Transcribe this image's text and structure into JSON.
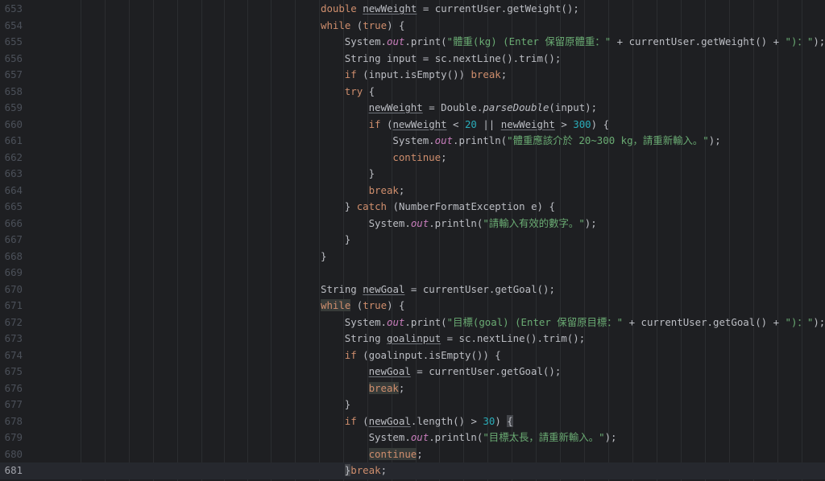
{
  "editor": {
    "theme_colors": {
      "background": "#1e1f22",
      "keyword": "#cf8e6d",
      "string": "#6aab73",
      "number": "#2aacb8",
      "static_field": "#c77dbb",
      "default_text": "#bcbec4",
      "line_number": "#4b5059",
      "current_line_number": "#a1a3ab"
    },
    "current_line": 681,
    "lines": [
      {
        "n": "653",
        "indent": 0,
        "tokens": [
          [
            "kw",
            "double"
          ],
          [
            "p",
            " "
          ],
          [
            "var",
            "newWeight"
          ],
          [
            "p",
            " = currentUser.getWeight();"
          ]
        ]
      },
      {
        "n": "654",
        "indent": 0,
        "tokens": [
          [
            "kw",
            "while"
          ],
          [
            "p",
            " ("
          ],
          [
            "kw",
            "true"
          ],
          [
            "p",
            ") {"
          ]
        ]
      },
      {
        "n": "655",
        "indent": 1,
        "tokens": [
          [
            "p",
            "System."
          ],
          [
            "static",
            "out"
          ],
          [
            "p",
            ".print("
          ],
          [
            "str",
            "\"體重(kg) (Enter 保留原體重：\""
          ],
          [
            "p",
            " + currentUser.getWeight() + "
          ],
          [
            "str",
            "\")：\""
          ],
          [
            "p",
            ");"
          ]
        ]
      },
      {
        "n": "656",
        "indent": 1,
        "tokens": [
          [
            "p",
            "String input = sc.nextLine().trim();"
          ]
        ]
      },
      {
        "n": "657",
        "indent": 1,
        "tokens": [
          [
            "kw",
            "if"
          ],
          [
            "p",
            " (input.isEmpty()) "
          ],
          [
            "kw",
            "break"
          ],
          [
            "p",
            ";"
          ]
        ]
      },
      {
        "n": "658",
        "indent": 1,
        "tokens": [
          [
            "kw",
            "try"
          ],
          [
            "p",
            " {"
          ]
        ]
      },
      {
        "n": "659",
        "indent": 2,
        "tokens": [
          [
            "var",
            "newWeight"
          ],
          [
            "p",
            " = Double."
          ],
          [
            "it",
            "parseDouble"
          ],
          [
            "p",
            "(input);"
          ]
        ]
      },
      {
        "n": "660",
        "indent": 2,
        "tokens": [
          [
            "kw",
            "if"
          ],
          [
            "p",
            " ("
          ],
          [
            "var",
            "newWeight"
          ],
          [
            "p",
            " < "
          ],
          [
            "num",
            "20"
          ],
          [
            "p",
            " || "
          ],
          [
            "var",
            "newWeight"
          ],
          [
            "p",
            " > "
          ],
          [
            "num",
            "300"
          ],
          [
            "p",
            ") {"
          ]
        ]
      },
      {
        "n": "661",
        "indent": 3,
        "tokens": [
          [
            "p",
            "System."
          ],
          [
            "static",
            "out"
          ],
          [
            "p",
            ".println("
          ],
          [
            "str",
            "\"體重應該介於 20~300 kg，請重新輸入。\""
          ],
          [
            "p",
            ");"
          ]
        ]
      },
      {
        "n": "662",
        "indent": 3,
        "tokens": [
          [
            "kw",
            "continue"
          ],
          [
            "p",
            ";"
          ]
        ]
      },
      {
        "n": "663",
        "indent": 2,
        "tokens": [
          [
            "p",
            "}"
          ]
        ]
      },
      {
        "n": "664",
        "indent": 2,
        "tokens": [
          [
            "kw",
            "break"
          ],
          [
            "p",
            ";"
          ]
        ]
      },
      {
        "n": "665",
        "indent": 1,
        "tokens": [
          [
            "p",
            "} "
          ],
          [
            "kw",
            "catch"
          ],
          [
            "p",
            " (NumberFormatException e) {"
          ]
        ]
      },
      {
        "n": "666",
        "indent": 2,
        "tokens": [
          [
            "p",
            "System."
          ],
          [
            "static",
            "out"
          ],
          [
            "p",
            ".println("
          ],
          [
            "str",
            "\"請輸入有效的數字。\""
          ],
          [
            "p",
            ");"
          ]
        ]
      },
      {
        "n": "667",
        "indent": 1,
        "tokens": [
          [
            "p",
            "}"
          ]
        ]
      },
      {
        "n": "668",
        "indent": 0,
        "tokens": [
          [
            "p",
            "}"
          ]
        ]
      },
      {
        "n": "669",
        "indent": 0,
        "tokens": []
      },
      {
        "n": "670",
        "indent": 0,
        "tokens": [
          [
            "p",
            "String "
          ],
          [
            "var",
            "newGoal"
          ],
          [
            "p",
            " = currentUser.getGoal();"
          ]
        ]
      },
      {
        "n": "671",
        "indent": 0,
        "tokens": [
          [
            "hlkw",
            "while"
          ],
          [
            "p",
            " ("
          ],
          [
            "kw",
            "true"
          ],
          [
            "p",
            ") {"
          ]
        ]
      },
      {
        "n": "672",
        "indent": 1,
        "tokens": [
          [
            "p",
            "System."
          ],
          [
            "static",
            "out"
          ],
          [
            "p",
            ".print("
          ],
          [
            "str",
            "\"目標(goal) (Enter 保留原目標：\""
          ],
          [
            "p",
            " + currentUser.getGoal() + "
          ],
          [
            "str",
            "\")：\""
          ],
          [
            "p",
            ");"
          ]
        ]
      },
      {
        "n": "673",
        "indent": 1,
        "tokens": [
          [
            "p",
            "String "
          ],
          [
            "var",
            "goalinput"
          ],
          [
            "p",
            " = sc.nextLine().trim();"
          ]
        ]
      },
      {
        "n": "674",
        "indent": 1,
        "tokens": [
          [
            "kw",
            "if"
          ],
          [
            "p",
            " (goalinput.isEmpty()) {"
          ]
        ]
      },
      {
        "n": "675",
        "indent": 2,
        "tokens": [
          [
            "var",
            "newGoal"
          ],
          [
            "p",
            " = currentUser.getGoal();"
          ]
        ]
      },
      {
        "n": "676",
        "indent": 2,
        "tokens": [
          [
            "hlkw",
            "break"
          ],
          [
            "p",
            ";"
          ]
        ]
      },
      {
        "n": "677",
        "indent": 1,
        "tokens": [
          [
            "p",
            "}"
          ]
        ]
      },
      {
        "n": "678",
        "indent": 1,
        "tokens": [
          [
            "kw",
            "if"
          ],
          [
            "p",
            " ("
          ],
          [
            "var",
            "newGoal"
          ],
          [
            "p",
            ".length() > "
          ],
          [
            "num",
            "30"
          ],
          [
            "p",
            ") "
          ],
          [
            "brace",
            "{"
          ]
        ]
      },
      {
        "n": "679",
        "indent": 2,
        "tokens": [
          [
            "p",
            "System."
          ],
          [
            "static",
            "out"
          ],
          [
            "p",
            ".println("
          ],
          [
            "str",
            "\"目標太長，請重新輸入。\""
          ],
          [
            "p",
            ");"
          ]
        ]
      },
      {
        "n": "680",
        "indent": 2,
        "tokens": [
          [
            "hlkw",
            "continue"
          ],
          [
            "p",
            ";"
          ]
        ]
      },
      {
        "n": "681",
        "indent": 1,
        "tokens": [
          [
            "brace",
            "}"
          ],
          [
            "kw",
            "break"
          ],
          [
            "p",
            ";"
          ]
        ]
      }
    ]
  }
}
